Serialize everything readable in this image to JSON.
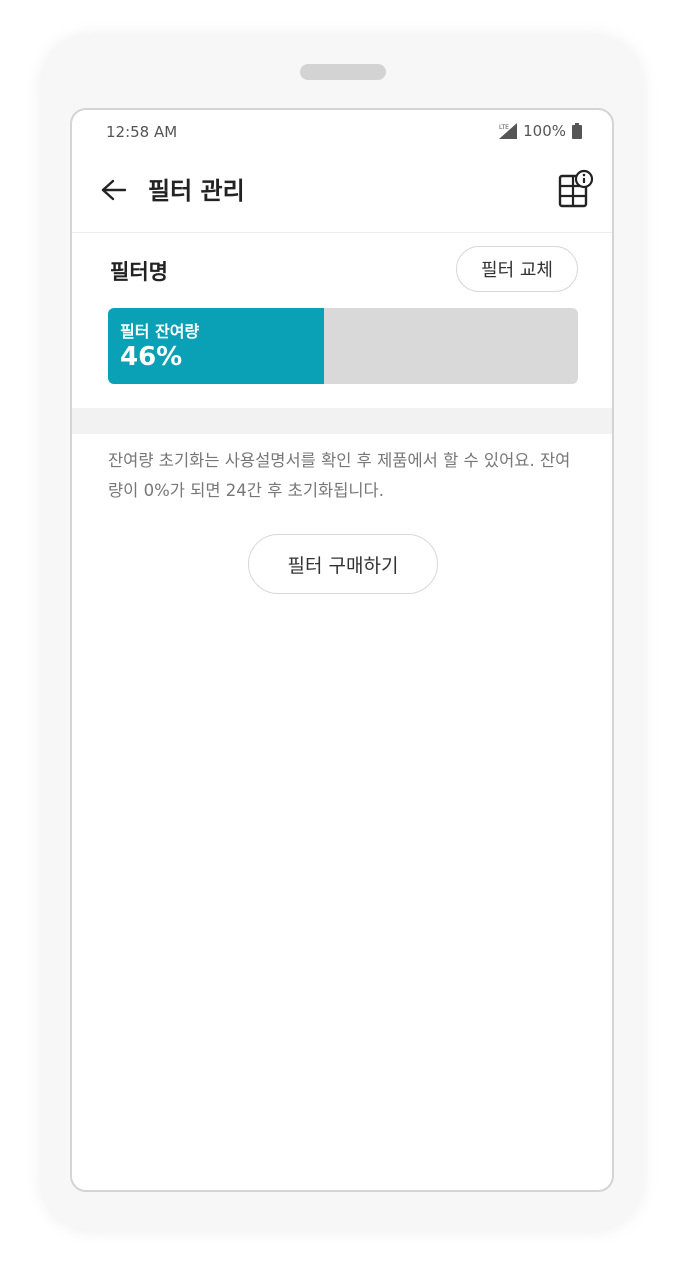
{
  "status_bar": {
    "time": "12:58 AM",
    "network": "LTE",
    "battery": "100%"
  },
  "header": {
    "title": "필터 관리",
    "back_icon": "arrow-left-icon",
    "info_icon": "filter-info-icon"
  },
  "filter": {
    "name": "필터명",
    "replace_label": "필터 교체",
    "remaining_label": "필터 잔여량",
    "remaining_value": "46%",
    "remaining_fraction": 0.46
  },
  "notice": {
    "text": "잔여량 초기화는 사용설명서를 확인 후 제품에서 할 수 있어요. 잔여량이 0%가 되면 24간 후 초기화됩니다."
  },
  "actions": {
    "buy_label": "필터 구매하기"
  },
  "colors": {
    "accent": "#0aa0b5",
    "track": "#d9d9d9"
  }
}
